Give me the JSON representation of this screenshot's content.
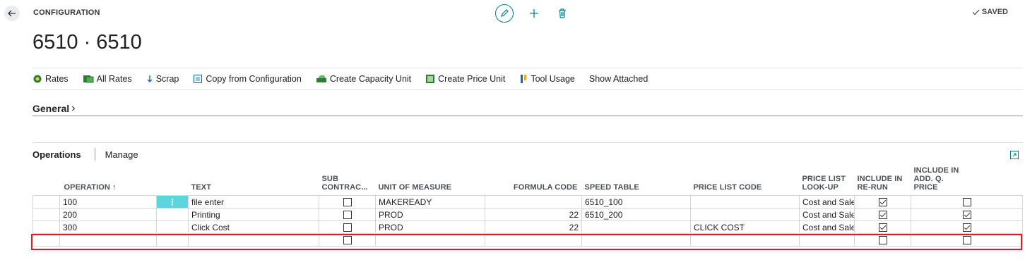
{
  "header": {
    "breadcrumb": "CONFIGURATION",
    "title": "6510 · 6510",
    "status": "SAVED"
  },
  "icons": {
    "back": "back-arrow-icon",
    "edit": "pencil-icon",
    "add": "plus-icon",
    "delete": "trash-icon",
    "saved": "checkmark-icon",
    "expand": "expand-icon"
  },
  "actions": [
    {
      "label": "Rates",
      "icon": "rates-icon"
    },
    {
      "label": "All Rates",
      "icon": "all-rates-icon"
    },
    {
      "label": "Scrap",
      "icon": "arrow-down-icon"
    },
    {
      "label": "Copy from Configuration",
      "icon": "copy-icon"
    },
    {
      "label": "Create Capacity Unit",
      "icon": "capacity-icon"
    },
    {
      "label": "Create Price Unit",
      "icon": "price-unit-icon"
    },
    {
      "label": "Tool Usage",
      "icon": "tool-icon"
    },
    {
      "label": "Show Attached",
      "icon": ""
    }
  ],
  "general": {
    "label": "General",
    "chevron": "›"
  },
  "operations": {
    "tab": "Operations",
    "manage": "Manage",
    "columns": {
      "operation": "OPERATION ↑",
      "text": "TEXT",
      "sub_line1": "SUB",
      "sub_line2": "CONTRAC...",
      "uom": "UNIT OF MEASURE",
      "formula": "FORMULA CODE",
      "speed": "SPEED TABLE",
      "price_code": "PRICE LIST CODE",
      "price_lookup": "PRICE LIST LOOK-UP",
      "rerun_line1": "INCLUDE IN",
      "rerun_line2": "RE-RUN",
      "addq_line1": "INCLUDE IN",
      "addq_line2": "ADD. Q.",
      "addq_line3": "PRICE"
    },
    "rows": [
      {
        "operation": "100",
        "text": "file enter",
        "sub": false,
        "uom": "MAKEREADY",
        "formula": "",
        "speed": "6510_100",
        "price_code": "",
        "price_lookup": "Cost and Sales Prices",
        "rerun": true,
        "addq": false
      },
      {
        "operation": "200",
        "text": "Printing",
        "sub": false,
        "uom": "PROD",
        "formula": "22",
        "speed": "6510_200",
        "price_code": "",
        "price_lookup": "Cost and Sales Prices",
        "rerun": true,
        "addq": true
      },
      {
        "operation": "300",
        "text": "Click Cost",
        "sub": false,
        "uom": "PROD",
        "formula": "22",
        "speed": "",
        "price_code": "CLICK COST",
        "price_lookup": "Cost and Sales Prices",
        "rerun": true,
        "addq": true
      },
      {
        "operation": "",
        "text": "",
        "sub": false,
        "uom": "",
        "formula": "",
        "speed": "",
        "price_code": "",
        "price_lookup": "",
        "rerun": false,
        "addq": false
      }
    ]
  },
  "colors": {
    "accent": "#00838f",
    "selected_cell": "#5bd5de",
    "highlight": "#e01b24"
  }
}
